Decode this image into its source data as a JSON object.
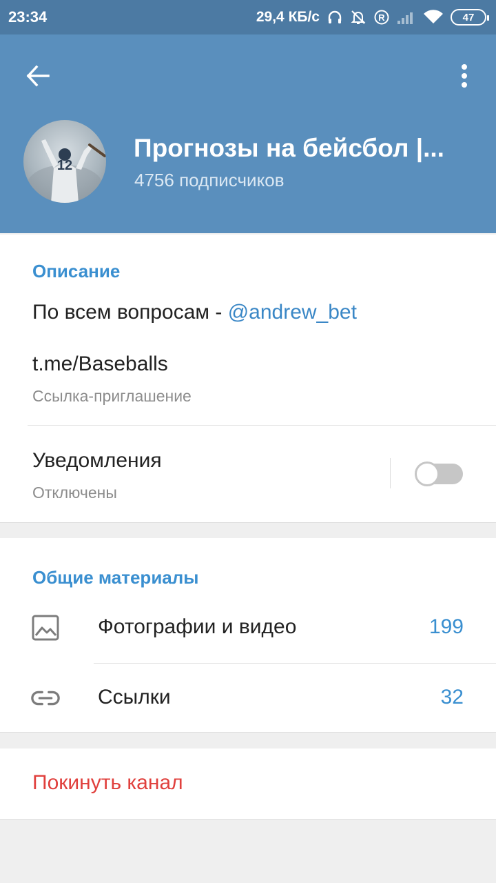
{
  "status_bar": {
    "time": "23:34",
    "speed": "29,4 КБ/с",
    "battery": "47",
    "icons": [
      "headphones-icon",
      "bell-off-icon",
      "roaming-r-icon",
      "signal-icon",
      "wifi-icon",
      "battery-icon"
    ]
  },
  "header": {
    "title": "Прогнозы на бейсбол |...",
    "subscribers": "4756 подписчиков",
    "avatar_number": "12",
    "bg_color": "#5a8fbd"
  },
  "info": {
    "section_title": "Описание",
    "description_prefix": "По всем вопросам - ",
    "description_mention": "@andrew_bet",
    "link_value": "t.me/Baseballs",
    "link_label": "Ссылка-приглашение",
    "notifications_title": "Уведомления",
    "notifications_status": "Отключены",
    "notifications_enabled": false
  },
  "shared": {
    "section_title": "Общие материалы",
    "items": [
      {
        "icon": "image-icon",
        "label": "Фотографии и видео",
        "count": "199"
      },
      {
        "icon": "link-icon",
        "label": "Ссылки",
        "count": "32"
      }
    ]
  },
  "actions": {
    "leave_label": "Покинуть канал",
    "leave_color": "#e0403d"
  },
  "colors": {
    "accent": "#3a8fd0",
    "status_bar": "#4c7aa3"
  }
}
